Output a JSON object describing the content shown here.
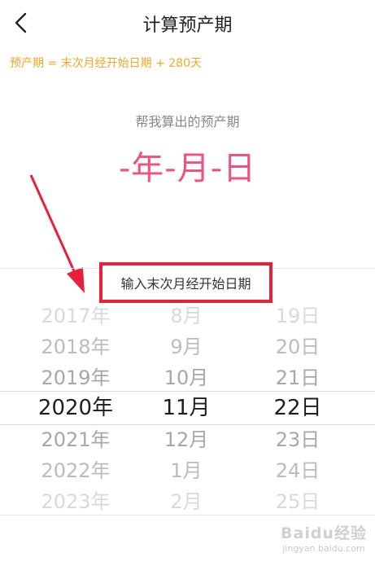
{
  "header": {
    "title": "计算预产期",
    "back_icon": "chevron-left-icon"
  },
  "formula": "预产期 = 末次月经开始日期 + 280天",
  "result": {
    "caption": "帮我算出的预产期",
    "value": "-年-月-日"
  },
  "picker": {
    "label": "输入末次月经开始日期",
    "years": [
      "2017年",
      "2018年",
      "2019年",
      "2020年",
      "2021年",
      "2022年",
      "2023年"
    ],
    "months": [
      "8月",
      "9月",
      "10月",
      "11月",
      "12月",
      "1月",
      "2月"
    ],
    "days": [
      "19日",
      "20日",
      "21日",
      "22日",
      "23日",
      "24日",
      "25日"
    ],
    "selected": {
      "year": "2020年",
      "month": "11月",
      "day": "22日"
    }
  },
  "watermark": {
    "logo": "Baidu经验",
    "url": "jingyan.baidu.com"
  },
  "colors": {
    "accent_orange": "#f5a623",
    "result_pink": "#f0517d",
    "annotation_red": "#e8203a"
  }
}
